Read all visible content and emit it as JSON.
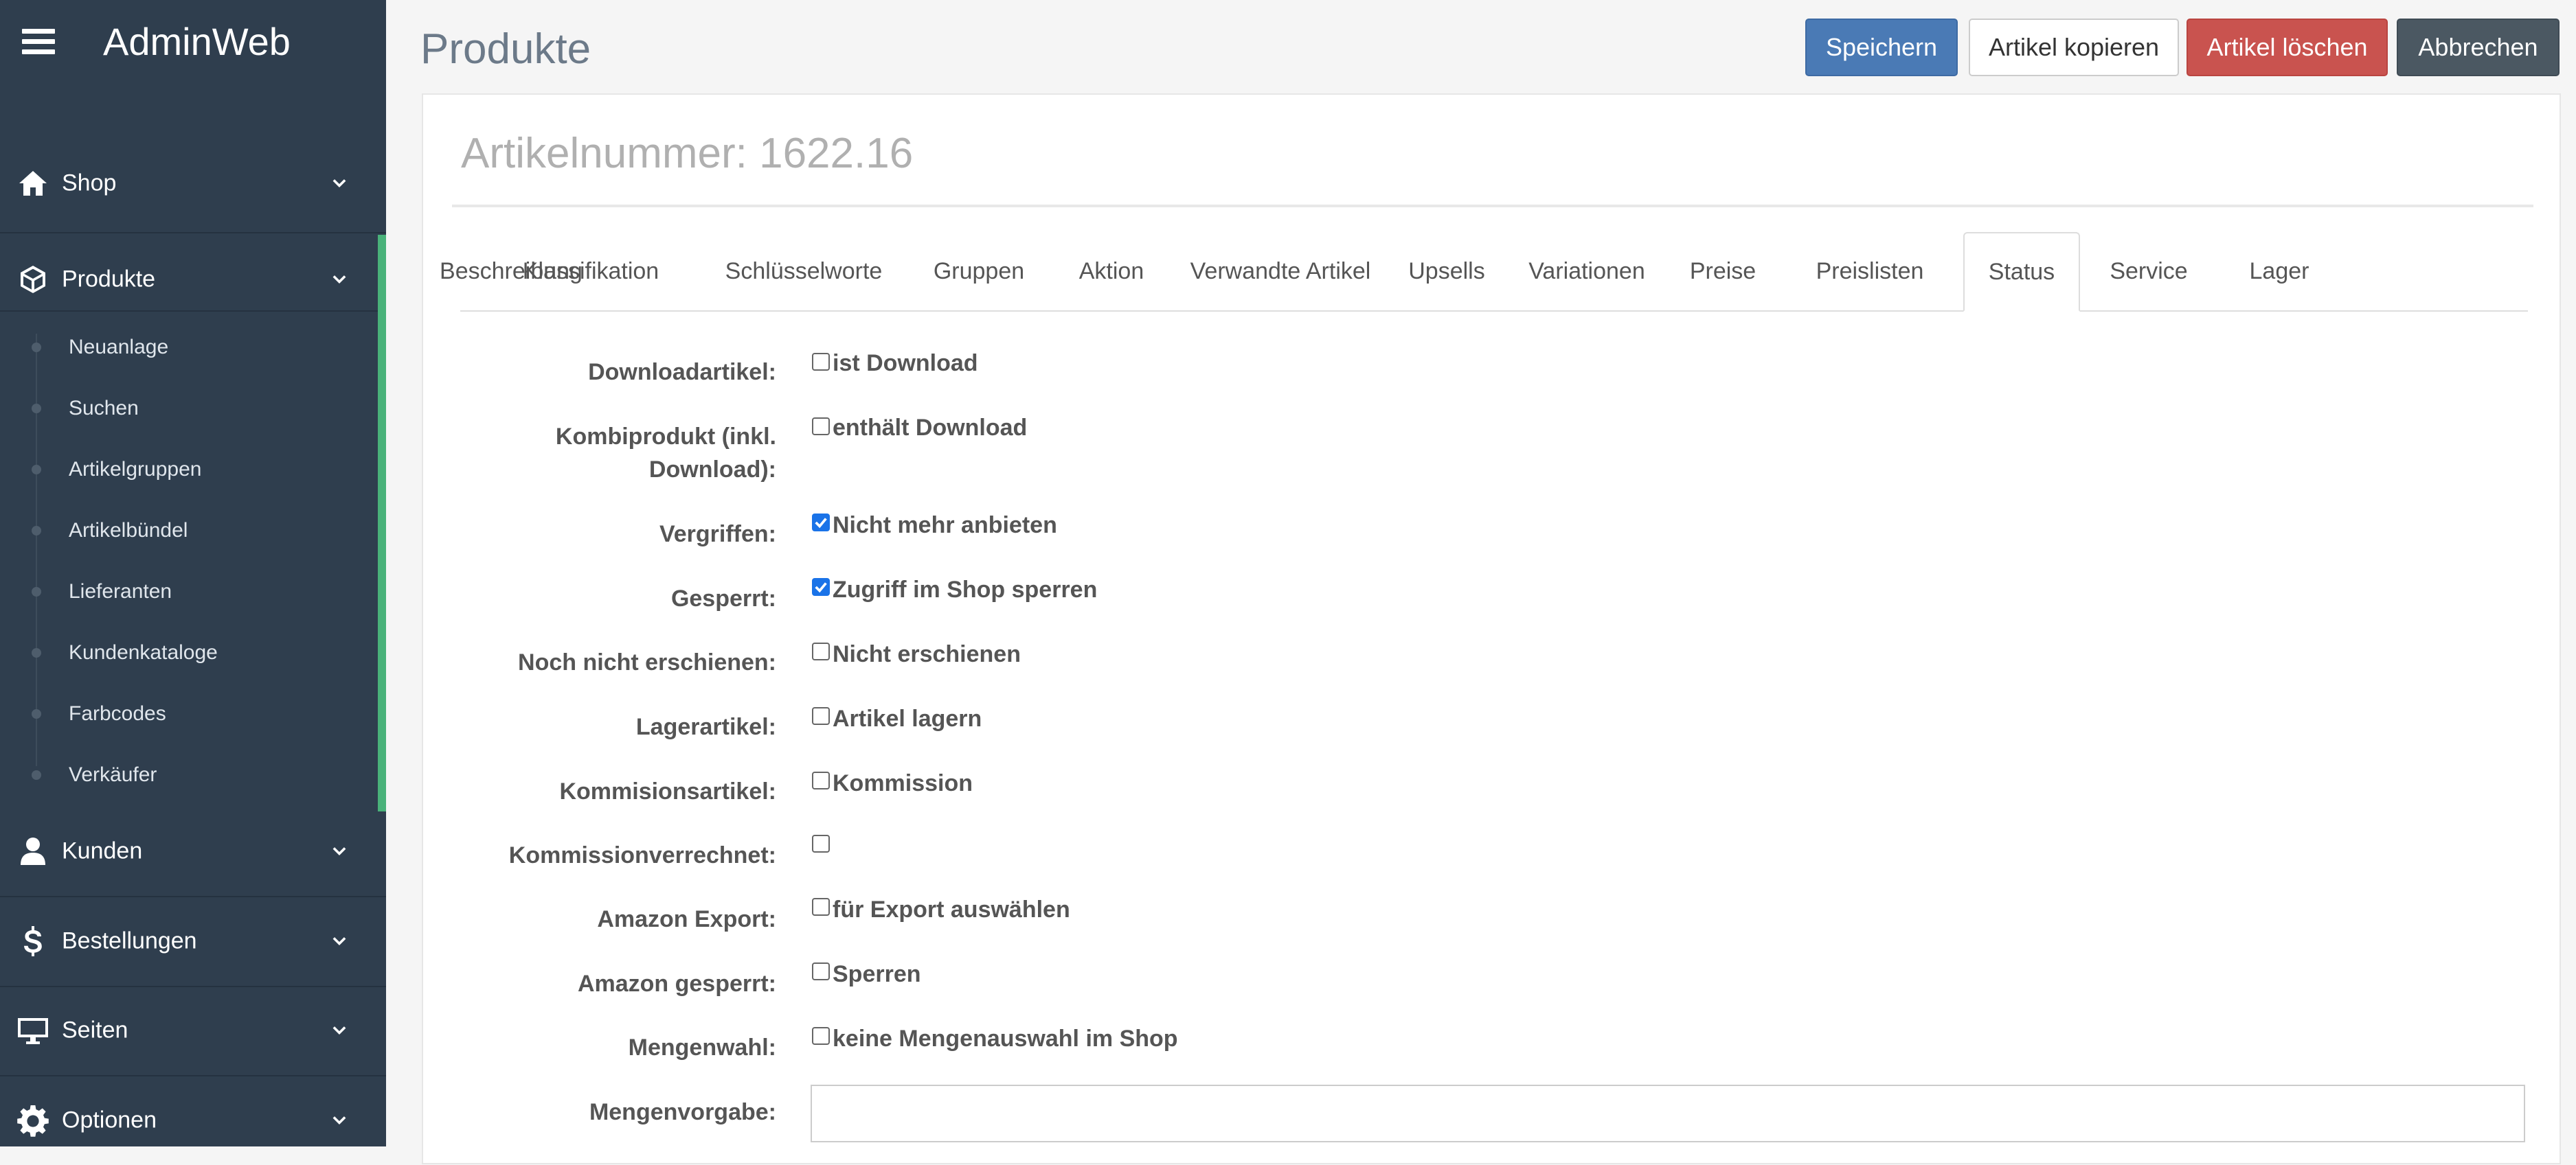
{
  "app": {
    "title": "AdminWeb"
  },
  "sidebar": {
    "items": [
      {
        "label": "Shop",
        "icon": "home-icon"
      },
      {
        "label": "Produkte",
        "icon": "cube-icon"
      },
      {
        "label": "Kunden",
        "icon": "user-icon"
      },
      {
        "label": "Bestellungen",
        "icon": "dollar-icon"
      },
      {
        "label": "Seiten",
        "icon": "monitor-icon"
      },
      {
        "label": "Optionen",
        "icon": "gear-icon"
      }
    ],
    "produkte_sub": [
      "Neuanlage",
      "Suchen",
      "Artikelgruppen",
      "Artikelbündel",
      "Lieferanten",
      "Kundenkataloge",
      "Farbcodes",
      "Verkäufer"
    ],
    "accent_color": "#49b27a"
  },
  "header": {
    "title": "Produkte",
    "buttons": {
      "save": "Speichern",
      "copy": "Artikel kopieren",
      "delete": "Artikel löschen",
      "cancel": "Abbrechen"
    }
  },
  "article": {
    "title": "Artikelnummer: 1622.16"
  },
  "tabs": [
    "Beschreibung",
    "Klassifikation",
    "Schlüsselworte",
    "Gruppen",
    "Aktion",
    "Verwandte Artikel",
    "Upsells",
    "Variationen",
    "Preise",
    "Preislisten",
    "Status",
    "Service",
    "Lager"
  ],
  "active_tab": "Status",
  "status_form": {
    "rows": [
      {
        "label": "Downloadartikel:",
        "checkbox_label": "ist Download",
        "checked": false
      },
      {
        "label": "Kombiprodukt (inkl. Download):",
        "checkbox_label": "enthält Download",
        "checked": false
      },
      {
        "label": "Vergriffen:",
        "checkbox_label": "Nicht mehr anbieten",
        "checked": true
      },
      {
        "label": "Gesperrt:",
        "checkbox_label": "Zugriff im Shop sperren",
        "checked": true
      },
      {
        "label": "Noch nicht erschienen:",
        "checkbox_label": "Nicht erschienen",
        "checked": false
      },
      {
        "label": "Lagerartikel:",
        "checkbox_label": "Artikel lagern",
        "checked": false
      },
      {
        "label": "Kommisionsartikel:",
        "checkbox_label": "Kommission",
        "checked": false
      },
      {
        "label": "Kommissionverrechnet:",
        "checkbox_label": "",
        "checked": false
      },
      {
        "label": "Amazon Export:",
        "checkbox_label": "für Export auswählen",
        "checked": false
      },
      {
        "label": "Amazon gesperrt:",
        "checkbox_label": "Sperren",
        "checked": false
      },
      {
        "label": "Mengenwahl:",
        "checkbox_label": "keine Mengenauswahl im Shop",
        "checked": false
      }
    ],
    "mengenvorgabe": {
      "label": "Mengenvorgabe:",
      "value": ""
    }
  }
}
